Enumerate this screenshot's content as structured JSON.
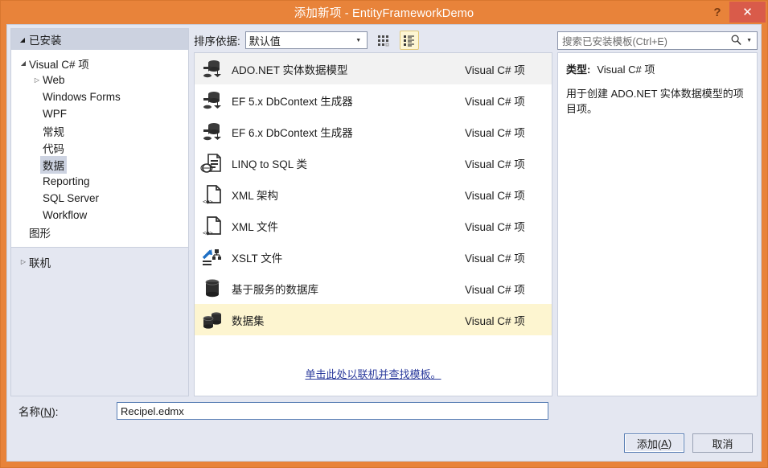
{
  "window": {
    "title": "添加新项 - EntityFrameworkDemo",
    "help_label": "?",
    "close_label": "✕",
    "accent_color": "#e8833a",
    "close_color": "#d95b4a"
  },
  "sidebar": {
    "header": "已安装",
    "items": [
      {
        "label": "Visual C# 项",
        "level": 1,
        "twisty": "▲",
        "selected": false
      },
      {
        "label": "Web",
        "level": 2,
        "twisty": "▷",
        "selected": false
      },
      {
        "label": "Windows Forms",
        "level": 2,
        "twisty": "",
        "selected": false
      },
      {
        "label": "WPF",
        "level": 2,
        "twisty": "",
        "selected": false
      },
      {
        "label": "常规",
        "level": 2,
        "twisty": "",
        "selected": false
      },
      {
        "label": "代码",
        "level": 2,
        "twisty": "",
        "selected": false
      },
      {
        "label": "数据",
        "level": 2,
        "twisty": "",
        "selected": true
      },
      {
        "label": "Reporting",
        "level": 2,
        "twisty": "",
        "selected": false
      },
      {
        "label": "SQL Server",
        "level": 2,
        "twisty": "",
        "selected": false
      },
      {
        "label": "Workflow",
        "level": 2,
        "twisty": "",
        "selected": false
      },
      {
        "label": "图形",
        "level": 1,
        "twisty": "",
        "selected": false
      }
    ],
    "online": {
      "label": "联机",
      "twisty": "▷"
    }
  },
  "toolbar": {
    "sort_label": "排序依据:",
    "sort_value": "默认值",
    "grid_view_icon": "small-icons-view-icon",
    "list_view_icon": "details-list-view-icon",
    "list_view_active": true
  },
  "search": {
    "placeholder": "搜索已安装模板(Ctrl+E)",
    "icon": "search-icon",
    "dropdown_icon": "chevron-down-icon"
  },
  "templates": {
    "kind_column": "Visual C# 项",
    "items": [
      {
        "name": "ADO.NET 实体数据模型",
        "kind": "Visual C# 项",
        "icon": "entity-data-model-icon",
        "state": "hover"
      },
      {
        "name": "EF 5.x DbContext 生成器",
        "kind": "Visual C# 项",
        "icon": "entity-data-model-icon",
        "state": ""
      },
      {
        "name": "EF 6.x DbContext 生成器",
        "kind": "Visual C# 项",
        "icon": "entity-data-model-icon",
        "state": ""
      },
      {
        "name": "LINQ to SQL 类",
        "kind": "Visual C# 项",
        "icon": "linq-to-sql-icon",
        "state": ""
      },
      {
        "name": "XML 架构",
        "kind": "Visual C# 项",
        "icon": "xml-schema-icon",
        "state": ""
      },
      {
        "name": "XML 文件",
        "kind": "Visual C# 项",
        "icon": "xml-file-icon",
        "state": ""
      },
      {
        "name": "XSLT 文件",
        "kind": "Visual C# 项",
        "icon": "xslt-file-icon",
        "state": ""
      },
      {
        "name": "基于服务的数据库",
        "kind": "Visual C# 项",
        "icon": "database-icon",
        "state": ""
      },
      {
        "name": "数据集",
        "kind": "Visual C# 项",
        "icon": "dataset-icon",
        "state": "selected"
      }
    ],
    "online_link": "单击此处以联机并查找模板。"
  },
  "details": {
    "type_label": "类型:",
    "type_value": "Visual C# 项",
    "description": "用于创建 ADO.NET 实体数据模型的项目项。"
  },
  "name_field": {
    "label_prefix": "名称(",
    "label_accel": "N",
    "label_suffix": "):",
    "value": "Recipel.edmx"
  },
  "footer": {
    "add_prefix": "添加(",
    "add_accel": "A",
    "add_suffix": ")",
    "cancel_label": "取消"
  }
}
